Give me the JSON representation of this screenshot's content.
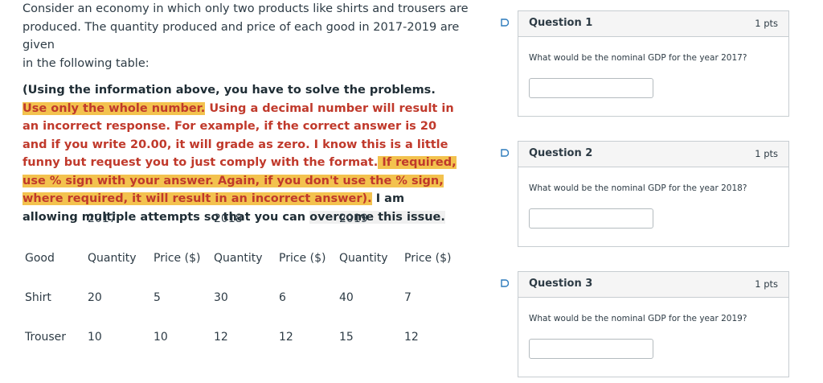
{
  "intro": {
    "line1": "Consider an economy in which only two products like shirts and trousers are",
    "line2": "produced. The quantity produced and price of each good in 2017-2019 are given",
    "line3": "in the following table:"
  },
  "instructions": {
    "part1": "(Using the information above, you have to solve the problems. ",
    "highlight1": "Use only the whole number.",
    "part2": " Using a decimal number will result in an incorrect response. For example, if the correct answer is 20 and if you write 20.00, it will grade as zero. I know this is a little funny but request you to just comply with the format.",
    "highlight2": " If required, use % sign with your answer.  Again, if you don't use the % sign, where required, it will result in an incorrect answer).",
    "part3": " I am allowing multiple attempts so that you can ",
    "part4": "overcome this issue."
  },
  "table": {
    "years": [
      "2017",
      "2018",
      "2019"
    ],
    "headers": [
      "Good",
      "Quantity",
      "Price ($)",
      "Quantity",
      "Price ($)",
      "Quantity",
      "Price ($)"
    ],
    "rows": [
      [
        "Shirt",
        "20",
        "5",
        "30",
        "6",
        "40",
        "7"
      ],
      [
        "Trouser",
        "10",
        "10",
        "12",
        "12",
        "15",
        "12"
      ]
    ]
  },
  "questions": [
    {
      "title": "Question 1",
      "points": "1 pts",
      "text": "What would be the nominal GDP for the year 2017?",
      "answer": ""
    },
    {
      "title": "Question 2",
      "points": "1 pts",
      "text": "What would be the nominal GDP for the year 2018?",
      "answer": ""
    },
    {
      "title": "Question 3",
      "points": "1 pts",
      "text": "What would be the nominal GDP for the year 2019?",
      "answer": ""
    }
  ],
  "colors": {
    "highlight": "#f3c24e",
    "warning_text": "#c0392b",
    "border": "#c7cdd1"
  },
  "icons": {
    "flag": "bookmark-flag-icon"
  }
}
